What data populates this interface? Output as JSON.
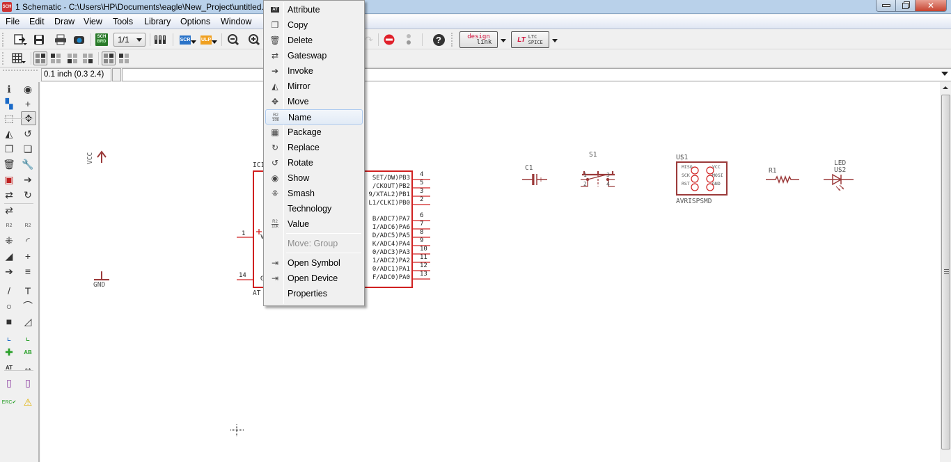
{
  "window": {
    "app_icon": "SCH",
    "title": "1 Schematic - C:\\Users\\HP\\Documents\\eagle\\New_Project\\untitled.",
    "controls": {
      "minimize": "minimize-icon",
      "restore": "restore-icon",
      "close": "close-icon",
      "close_glyph": "✕"
    }
  },
  "menubar": [
    "File",
    "Edit",
    "Draw",
    "View",
    "Tools",
    "Library",
    "Options",
    "Window"
  ],
  "toolbar": {
    "sheet_select": "1/1",
    "sch_brd_label_top": "SCH",
    "sch_brd_label_bottom": "BRD",
    "scr_label": "SCR",
    "ulp_label": "ULP",
    "help_glyph": "?",
    "designlink_top": "design",
    "designlink_bottom": "link",
    "ltspice_top": "LTC",
    "ltspice_bottom": "SPICE",
    "accent_stop": "#e0202a"
  },
  "commandbar": {
    "grid_value": "0.1 inch (0.3 2.4)",
    "command_value": ""
  },
  "context_menu": {
    "items": [
      {
        "label": "Attribute",
        "icon": "attribute-icon",
        "glyph": "AT"
      },
      {
        "label": "Copy",
        "icon": "copy-icon",
        "glyph": "❐"
      },
      {
        "label": "Delete",
        "icon": "trash-icon",
        "glyph": "🗑"
      },
      {
        "label": "Gateswap",
        "icon": "gateswap-icon",
        "glyph": "⇄"
      },
      {
        "label": "Invoke",
        "icon": "invoke-icon",
        "glyph": "➔"
      },
      {
        "label": "Mirror",
        "icon": "mirror-icon",
        "glyph": "◭"
      },
      {
        "label": "Move",
        "icon": "move-icon",
        "glyph": "✥"
      },
      {
        "label": "Name",
        "icon": "name-icon",
        "glyph": "R2",
        "highlighted": true
      },
      {
        "label": "Package",
        "icon": "package-icon",
        "glyph": "▦"
      },
      {
        "label": "Replace",
        "icon": "replace-icon",
        "glyph": "↻"
      },
      {
        "label": "Rotate",
        "icon": "rotate-icon",
        "glyph": "↺"
      },
      {
        "label": "Show",
        "icon": "eye-icon",
        "glyph": "◉"
      },
      {
        "label": "Smash",
        "icon": "smash-icon",
        "glyph": "⁜"
      },
      {
        "label": "Technology",
        "icon": "",
        "glyph": ""
      },
      {
        "label": "Value",
        "icon": "value-icon",
        "glyph": "R2"
      }
    ],
    "disabled_item": {
      "label": "Move: Group"
    },
    "bottom_items": [
      {
        "label": "Open Symbol",
        "icon": "open-symbol-icon",
        "glyph": "⇥"
      },
      {
        "label": "Open Device",
        "icon": "open-device-icon",
        "glyph": "⇥"
      },
      {
        "label": "Properties",
        "icon": "",
        "glyph": ""
      }
    ]
  },
  "left_toolbar": [
    {
      "name": "info-icon",
      "glyph": "ℹ"
    },
    {
      "name": "eye-icon",
      "glyph": "◉"
    },
    {
      "name": "layer-settings-icon",
      "glyph": "▚"
    },
    {
      "name": "mark-icon",
      "glyph": "+"
    },
    {
      "name": "select-icon",
      "glyph": "⬚"
    },
    {
      "name": "move-icon",
      "glyph": "✥"
    },
    {
      "name": "mirror-icon",
      "glyph": "◭"
    },
    {
      "name": "rotate-icon",
      "glyph": "↺"
    },
    {
      "name": "copy-icon",
      "glyph": "❐"
    },
    {
      "name": "paste-icon",
      "glyph": "❏"
    },
    {
      "name": "delete-icon",
      "glyph": "🗑"
    },
    {
      "name": "wrench-icon",
      "glyph": "🔧"
    },
    {
      "name": "add-part-icon",
      "glyph": "▣"
    },
    {
      "name": "invoke-icon",
      "glyph": "➔"
    },
    {
      "name": "pinswap-icon",
      "glyph": "⇄"
    },
    {
      "name": "replace-icon",
      "glyph": "↻"
    },
    {
      "name": "gateswap-icon",
      "glyph": "⇄"
    },
    {
      "name": "name-icon",
      "glyph": "R2"
    },
    {
      "name": "value-icon",
      "glyph": "R2"
    },
    {
      "name": "smash-icon",
      "glyph": "⁜"
    },
    {
      "name": "miter-icon",
      "glyph": "◜"
    },
    {
      "name": "split-icon",
      "glyph": "◢"
    },
    {
      "name": "optimize-icon",
      "glyph": "+"
    },
    {
      "name": "wire-split-icon",
      "glyph": "➔"
    },
    {
      "name": "bus-break-icon",
      "glyph": "≡"
    },
    {
      "name": "line-icon",
      "glyph": "/"
    },
    {
      "name": "text-icon",
      "glyph": "T"
    },
    {
      "name": "circle-icon",
      "glyph": "○"
    },
    {
      "name": "arc-icon",
      "glyph": "⌒"
    },
    {
      "name": "rectangle-icon",
      "glyph": "■"
    },
    {
      "name": "polygon-icon",
      "glyph": "◿"
    },
    {
      "name": "net-icon",
      "glyph": "⌞"
    },
    {
      "name": "bus-icon",
      "glyph": "⌞"
    },
    {
      "name": "junction-icon",
      "glyph": "✚"
    },
    {
      "name": "label-icon",
      "glyph": "AB"
    },
    {
      "name": "attribute-icon",
      "glyph": "AT"
    },
    {
      "name": "dimension-icon",
      "glyph": "↔"
    },
    {
      "name": "frame-icon",
      "glyph": "▯"
    },
    {
      "name": "module-icon",
      "glyph": "▯"
    },
    {
      "name": "erc-icon",
      "glyph": "ERC✔"
    },
    {
      "name": "warning-icon",
      "glyph": "⚠"
    }
  ],
  "schematic": {
    "wire_color": "#9b3a3a",
    "ic_color": "#d02020",
    "vcc_label": "VCC",
    "gnd_label": "GND",
    "ic_name": "IC1",
    "ic_value": "AT",
    "ic_left_pins": [
      {
        "num": "1",
        "sig": "V"
      },
      {
        "num": "14",
        "sig": "G"
      }
    ],
    "ic_right_pins": [
      {
        "num": "4",
        "sig": "SET/DW)PB3"
      },
      {
        "num": "5",
        "sig": "/CKOUT)PB2"
      },
      {
        "num": "3",
        "sig": "9/XTAL2)PB1"
      },
      {
        "num": "2",
        "sig": "L1/CLKI)PB0"
      },
      {
        "num": "6",
        "sig": "B/ADC7)PA7"
      },
      {
        "num": "7",
        "sig": "I/ADC6)PA6"
      },
      {
        "num": "8",
        "sig": "D/ADC5)PA5"
      },
      {
        "num": "9",
        "sig": "K/ADC4)PA4"
      },
      {
        "num": "10",
        "sig": "0/ADC3)PA3"
      },
      {
        "num": "11",
        "sig": "1/ADC2)PA2"
      },
      {
        "num": "12",
        "sig": "0/ADC1)PA1"
      },
      {
        "num": "13",
        "sig": "F/ADC0)PA0"
      }
    ],
    "c1_label": "C1",
    "s1_label": "S1",
    "s1_pins": [
      "1",
      "2",
      "3",
      "4"
    ],
    "u1_name": "U$1",
    "u1_value": "AVRISPSMD",
    "u1_pins_left": [
      "MISO",
      "SCK",
      "RST"
    ],
    "u1_pins_right": [
      "VCC",
      "MOSI",
      "GND"
    ],
    "r1_label": "R1",
    "led_value": "LED",
    "led_name": "U$2"
  }
}
